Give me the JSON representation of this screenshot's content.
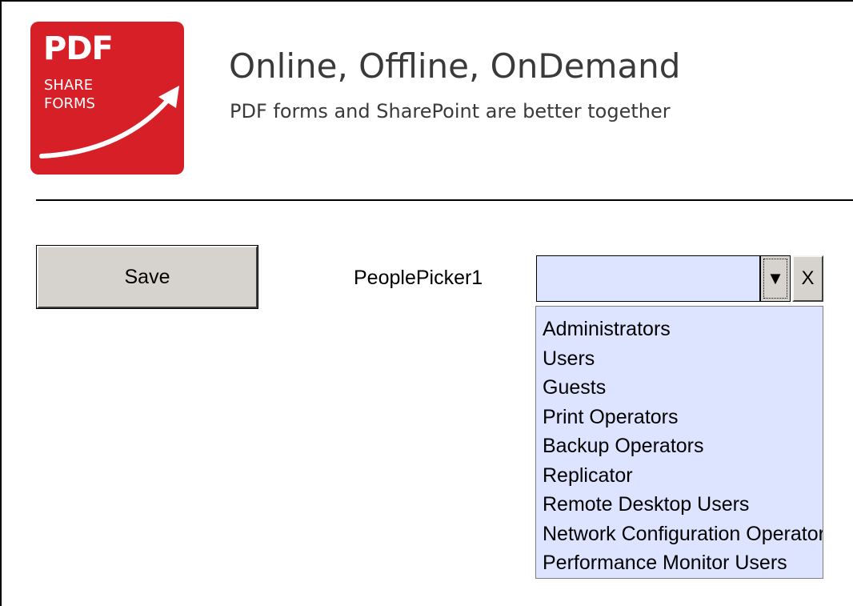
{
  "logo": {
    "line1": "PDF",
    "line2": "SHARE",
    "line3": "FORMS",
    "brand_color": "#d71f27"
  },
  "header": {
    "title": "Online, Offline, OnDemand",
    "subtitle": "PDF forms and SharePoint are better together"
  },
  "toolbar": {
    "save_label": "Save"
  },
  "people_picker": {
    "label": "PeoplePicker1",
    "value": "",
    "dropdown_icon": "▼",
    "clear_label": "X",
    "field_color": "#dde4ff",
    "options": [
      "Administrators",
      "Users",
      "Guests",
      "Print Operators",
      "Backup Operators",
      "Replicator",
      "Remote Desktop Users",
      "Network Configuration Operators",
      "Performance Monitor Users"
    ]
  }
}
